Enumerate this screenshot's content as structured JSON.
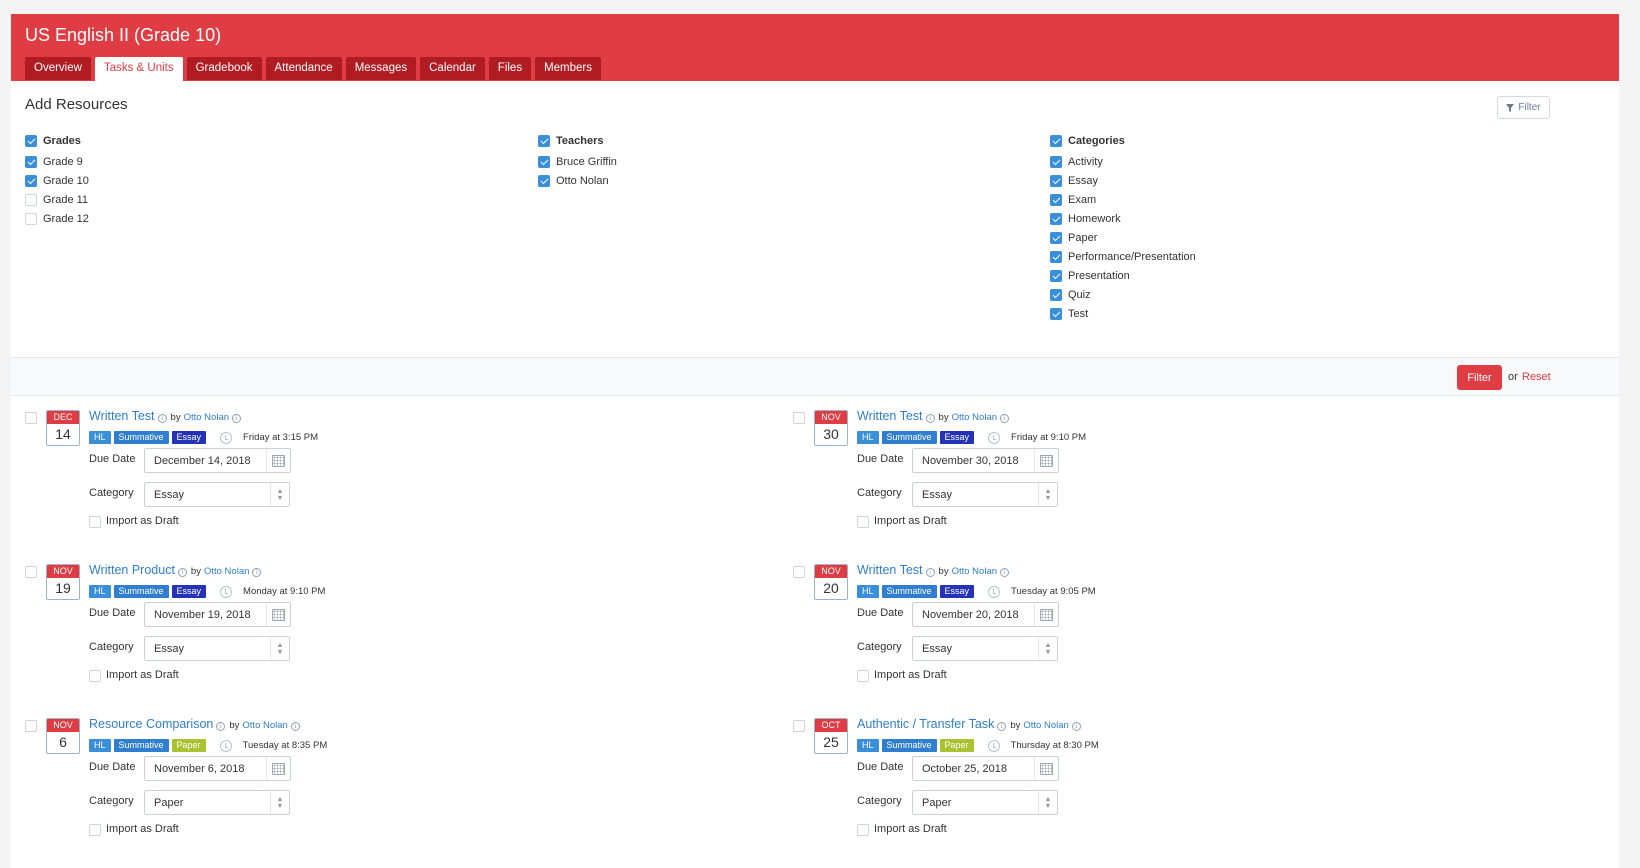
{
  "course": {
    "title": "US English II (Grade 10)"
  },
  "tabs": [
    {
      "label": "Overview",
      "active": false
    },
    {
      "label": "Tasks & Units",
      "active": true
    },
    {
      "label": "Gradebook",
      "active": false
    },
    {
      "label": "Attendance",
      "active": false
    },
    {
      "label": "Messages",
      "active": false
    },
    {
      "label": "Calendar",
      "active": false
    },
    {
      "label": "Files",
      "active": false
    },
    {
      "label": "Members",
      "active": false
    }
  ],
  "panel": {
    "title": "Add Resources",
    "filter_button": "Filter",
    "grades": {
      "header": "Grades",
      "checked": true,
      "items": [
        {
          "label": "Grade 9",
          "checked": true
        },
        {
          "label": "Grade 10",
          "checked": true
        },
        {
          "label": "Grade 11",
          "checked": false
        },
        {
          "label": "Grade 12",
          "checked": false
        }
      ]
    },
    "teachers": {
      "header": "Teachers",
      "checked": true,
      "items": [
        {
          "label": "Bruce Griffin",
          "checked": true
        },
        {
          "label": "Otto Nolan",
          "checked": true
        }
      ]
    },
    "categories": {
      "header": "Categories",
      "checked": true,
      "items": [
        {
          "label": "Activity",
          "checked": true
        },
        {
          "label": "Essay",
          "checked": true
        },
        {
          "label": "Exam",
          "checked": true
        },
        {
          "label": "Homework",
          "checked": true
        },
        {
          "label": "Paper",
          "checked": true
        },
        {
          "label": "Performance/Presentation",
          "checked": true
        },
        {
          "label": "Presentation",
          "checked": true
        },
        {
          "label": "Quiz",
          "checked": true
        },
        {
          "label": "Test",
          "checked": true
        }
      ]
    }
  },
  "filter_bar": {
    "filter_label": "Filter",
    "or_text": "or",
    "reset_label": "Reset"
  },
  "labels": {
    "by": "by",
    "due_date": "Due Date",
    "category": "Category",
    "import_draft": "Import as Draft"
  },
  "colors": {
    "accent": "#e03c44",
    "hl_tag": "#3a8fd9",
    "summative_tag": "#2f7ecf",
    "essay_tag": "#2433b5",
    "paper_tag": "#a9c22f",
    "link": "#2f7ecf"
  },
  "tasks": [
    {
      "month": "DEC",
      "day": "14",
      "title": "Written Test",
      "author": "Otto Nolan",
      "tags": [
        "HL",
        "Summative",
        "Essay"
      ],
      "time": "Friday at 3:15 PM",
      "due_date": "December 14, 2018",
      "category": "Essay"
    },
    {
      "month": "NOV",
      "day": "30",
      "title": "Written Test",
      "author": "Otto Nolan",
      "tags": [
        "HL",
        "Summative",
        "Essay"
      ],
      "time": "Friday at 9:10 PM",
      "due_date": "November 30, 2018",
      "category": "Essay"
    },
    {
      "month": "NOV",
      "day": "19",
      "title": "Written Product",
      "author": "Otto Nolan",
      "tags": [
        "HL",
        "Summative",
        "Essay"
      ],
      "time": "Monday at 9:10 PM",
      "due_date": "November 19, 2018",
      "category": "Essay"
    },
    {
      "month": "NOV",
      "day": "20",
      "title": "Written Test",
      "author": "Otto Nolan",
      "tags": [
        "HL",
        "Summative",
        "Essay"
      ],
      "time": "Tuesday at 9:05 PM",
      "due_date": "November 20, 2018",
      "category": "Essay"
    },
    {
      "month": "NOV",
      "day": "6",
      "title": "Resource Comparison",
      "author": "Otto Nolan",
      "tags": [
        "HL",
        "Summative",
        "Paper"
      ],
      "time": "Tuesday at 8:35 PM",
      "due_date": "November 6, 2018",
      "category": "Paper"
    },
    {
      "month": "OCT",
      "day": "25",
      "title": "Authentic / Transfer Task",
      "author": "Otto Nolan",
      "tags": [
        "HL",
        "Summative",
        "Paper"
      ],
      "time": "Thursday at 8:30 PM",
      "due_date": "October 25, 2018",
      "category": "Paper"
    }
  ]
}
